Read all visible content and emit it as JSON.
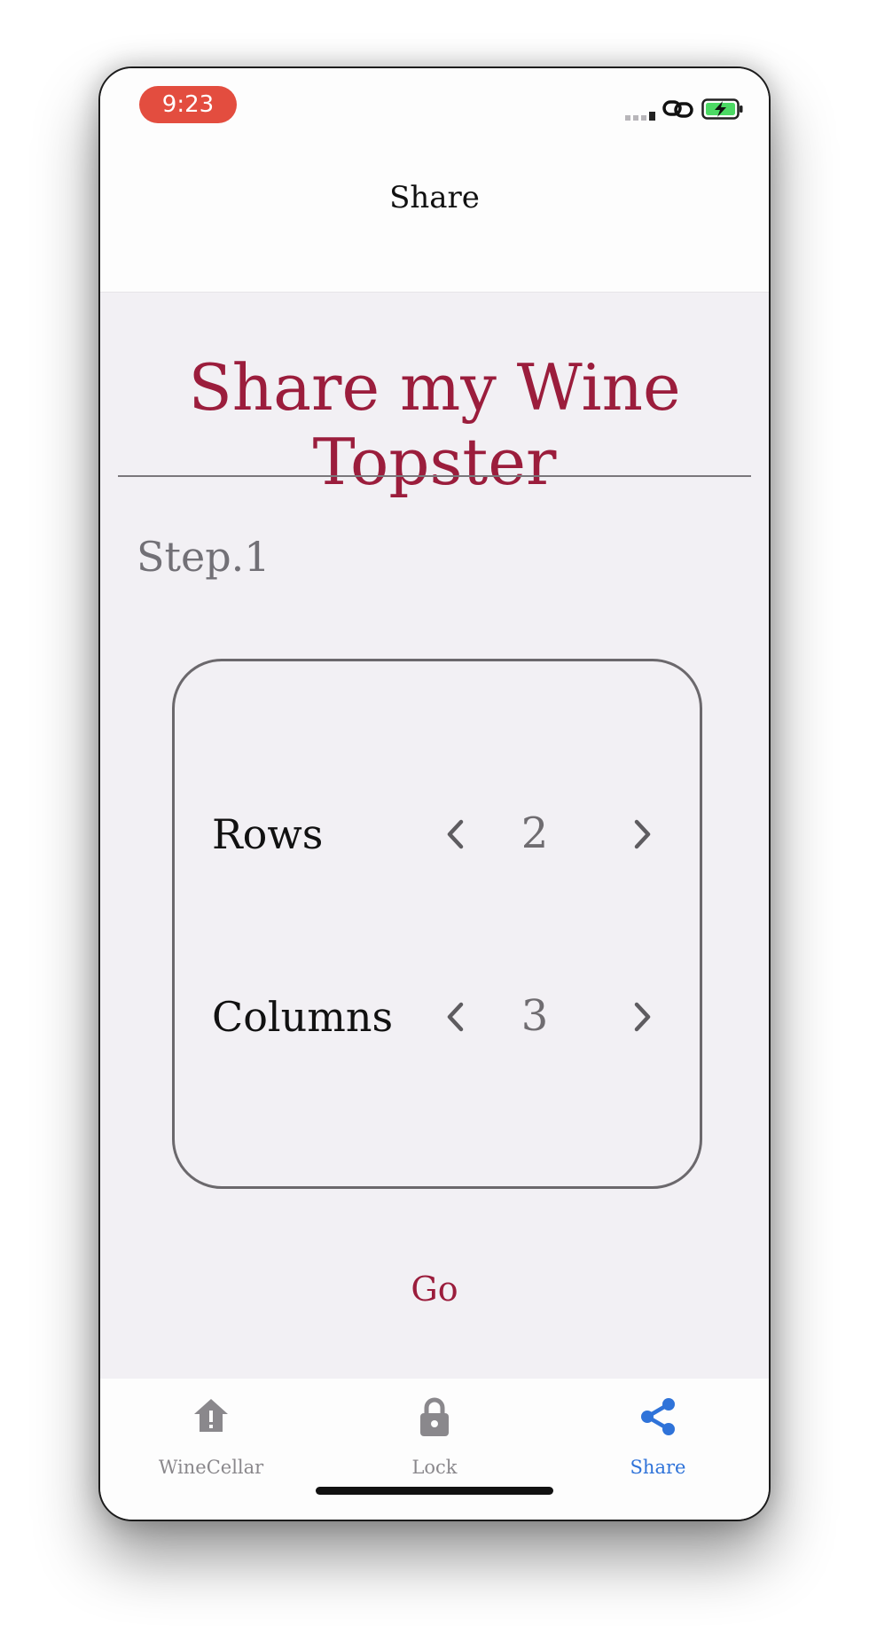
{
  "status": {
    "time": "9:23"
  },
  "nav": {
    "title": "Share"
  },
  "page": {
    "title": "Share my Wine Topster",
    "step_label": "Step.1"
  },
  "grid": {
    "rows_label": "Rows",
    "rows_value": "2",
    "columns_label": "Columns",
    "columns_value": "3"
  },
  "go_label": "Go",
  "tabs": [
    {
      "label": "WineCellar",
      "icon": "home-alert-icon",
      "active": false
    },
    {
      "label": "Lock",
      "icon": "lock-icon",
      "active": false
    },
    {
      "label": "Share",
      "icon": "share-icon",
      "active": true
    }
  ],
  "colors": {
    "accent": "#9b1d3c",
    "tab_active": "#2f73d9",
    "tab_inactive": "#8a888c",
    "time_pill": "#e34d3f"
  }
}
